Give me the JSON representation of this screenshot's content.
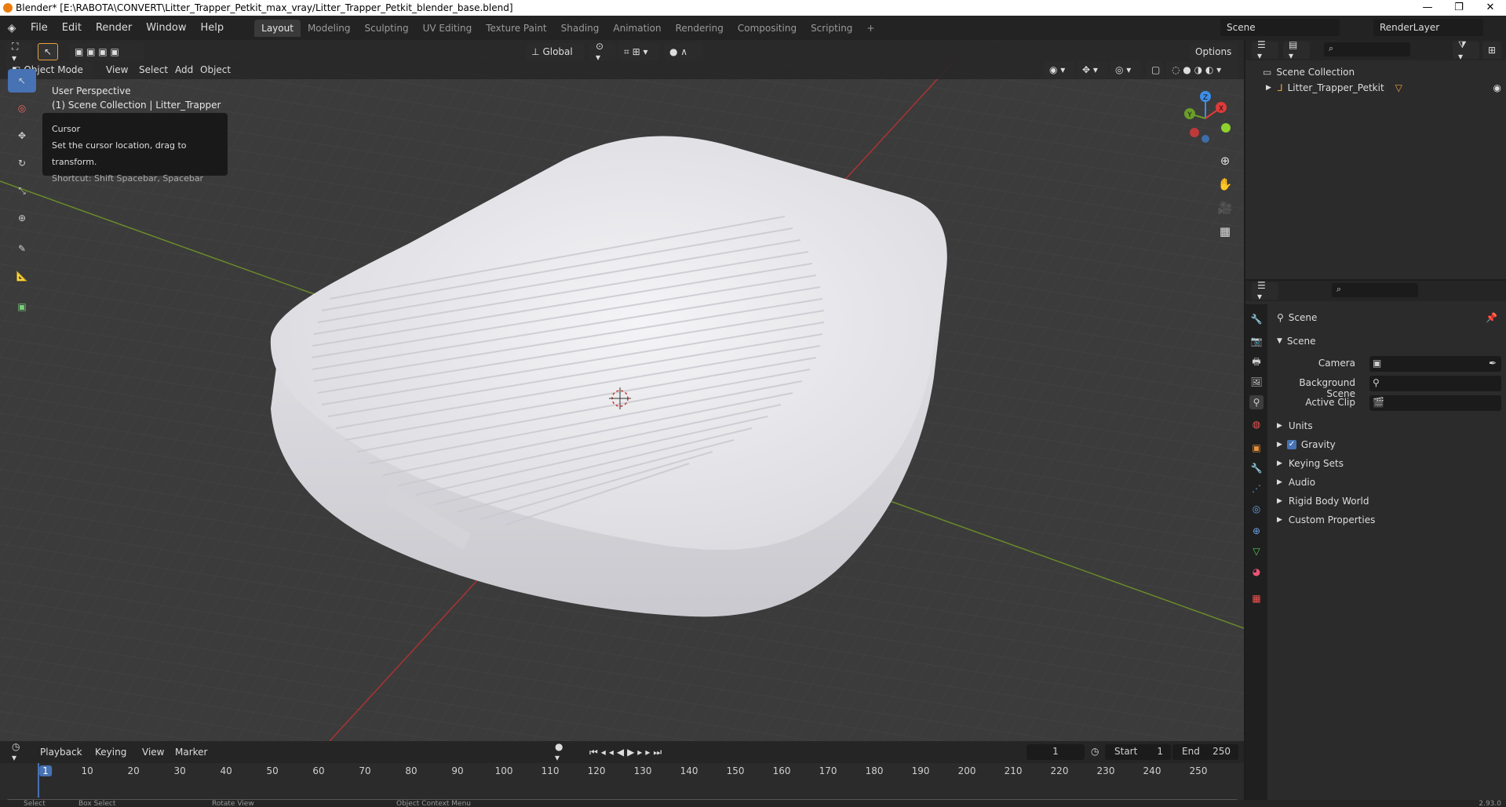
{
  "window": {
    "title": "Blender* [E:\\RABOTA\\CONVERT\\Litter_Trapper_Petkit_max_vray/Litter_Trapper_Petkit_blender_base.blend]",
    "controls": [
      "—",
      "❐",
      "✕"
    ]
  },
  "menu": [
    "File",
    "Edit",
    "Render",
    "Window",
    "Help"
  ],
  "workspaces": [
    "Layout",
    "Modeling",
    "Sculpting",
    "UV Editing",
    "Texture Paint",
    "Shading",
    "Animation",
    "Rendering",
    "Compositing",
    "Scripting"
  ],
  "scene": {
    "name": "Scene",
    "render_layer": "RenderLayer"
  },
  "viewport": {
    "mode": "Object Mode",
    "menus": [
      "View",
      "Select",
      "Add",
      "Object"
    ],
    "orientation": "Global",
    "options_label": "Options",
    "overlay_title": "User Perspective",
    "overlay_sub": "(1) Scene Collection | Litter_Trapper",
    "tooltip": {
      "title": "Cursor",
      "desc": "Set the cursor location, drag to transform.",
      "shortcut": "Shortcut: Shift Spacebar, Spacebar"
    },
    "gizmo": {
      "x": "X",
      "y": "Y",
      "z": "Z"
    }
  },
  "outliner": {
    "collection": "Scene Collection",
    "items": [
      "Litter_Trapper_Petkit"
    ]
  },
  "properties": {
    "header": "Scene",
    "panel": "Scene",
    "fields": [
      {
        "label": "Camera"
      },
      {
        "label": "Background Scene"
      },
      {
        "label": "Active Clip"
      }
    ],
    "sections": [
      {
        "label": "Units",
        "checkbox": false
      },
      {
        "label": "Gravity",
        "checkbox": true
      },
      {
        "label": "Keying Sets",
        "checkbox": false
      },
      {
        "label": "Audio",
        "checkbox": false
      },
      {
        "label": "Rigid Body World",
        "checkbox": false
      },
      {
        "label": "Custom Properties",
        "checkbox": false
      }
    ]
  },
  "timeline": {
    "menus": [
      "Playback",
      "Keying",
      "View",
      "Marker"
    ],
    "current_frame": "1",
    "start_label": "Start",
    "start": "1",
    "end_label": "End",
    "end": "250",
    "ticks": [
      "1",
      "10",
      "20",
      "30",
      "40",
      "50",
      "60",
      "70",
      "80",
      "90",
      "100",
      "110",
      "120",
      "130",
      "140",
      "150",
      "160",
      "170",
      "180",
      "190",
      "200",
      "210",
      "220",
      "230",
      "240",
      "250"
    ]
  },
  "status": [
    "Select",
    "Box Select",
    "Rotate View",
    "Object Context Menu",
    "2.93.0"
  ]
}
